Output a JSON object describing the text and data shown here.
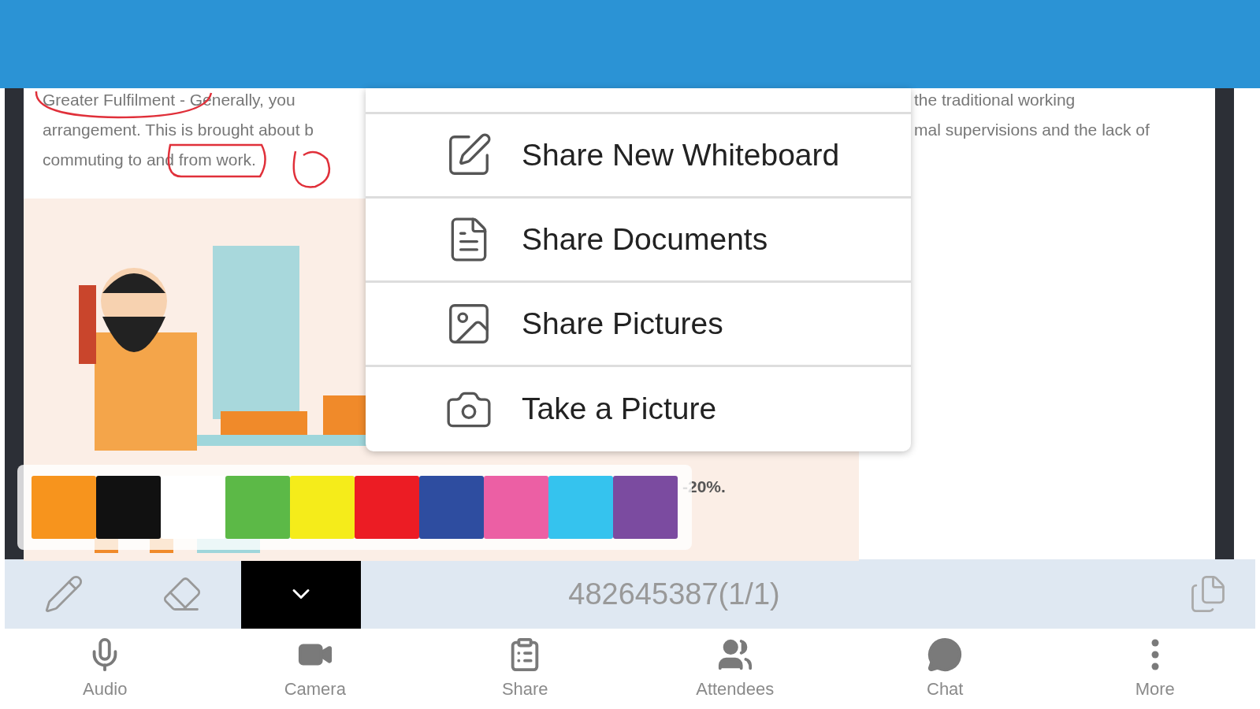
{
  "document": {
    "left_lines": [
      "Greater Fulfilment - Generally, you",
      "arrangement. This is brought about b",
      "commuting to and from work."
    ],
    "right_lines": [
      "the traditional working",
      "mal supervisions and the lack of"
    ],
    "figure_caption": "-20%."
  },
  "share_menu": {
    "items": [
      {
        "kind": "whiteboard",
        "label": "Share New Whiteboard"
      },
      {
        "kind": "documents",
        "label": "Share Documents"
      },
      {
        "kind": "pictures",
        "label": "Share Pictures"
      },
      {
        "kind": "camera",
        "label": "Take a Picture"
      }
    ]
  },
  "palette": [
    {
      "color": "#f7941d"
    },
    {
      "color": "#111111"
    },
    {
      "color": "#ffffff"
    },
    {
      "color": "#5cb947"
    },
    {
      "color": "#f5ec1a"
    },
    {
      "color": "#ec1c24"
    },
    {
      "color": "#2e4da0"
    },
    {
      "color": "#ec5fa4"
    },
    {
      "color": "#35c3ee"
    },
    {
      "color": "#7b4ba0"
    }
  ],
  "toolbar": {
    "meeting_id": "482645387(1/1)"
  },
  "tab_bar": [
    {
      "kind": "audio",
      "label": "Audio"
    },
    {
      "kind": "camera",
      "label": "Camera"
    },
    {
      "kind": "share",
      "label": "Share"
    },
    {
      "kind": "attendees",
      "label": "Attendees"
    },
    {
      "kind": "chat",
      "label": "Chat"
    },
    {
      "kind": "more",
      "label": "More"
    }
  ]
}
